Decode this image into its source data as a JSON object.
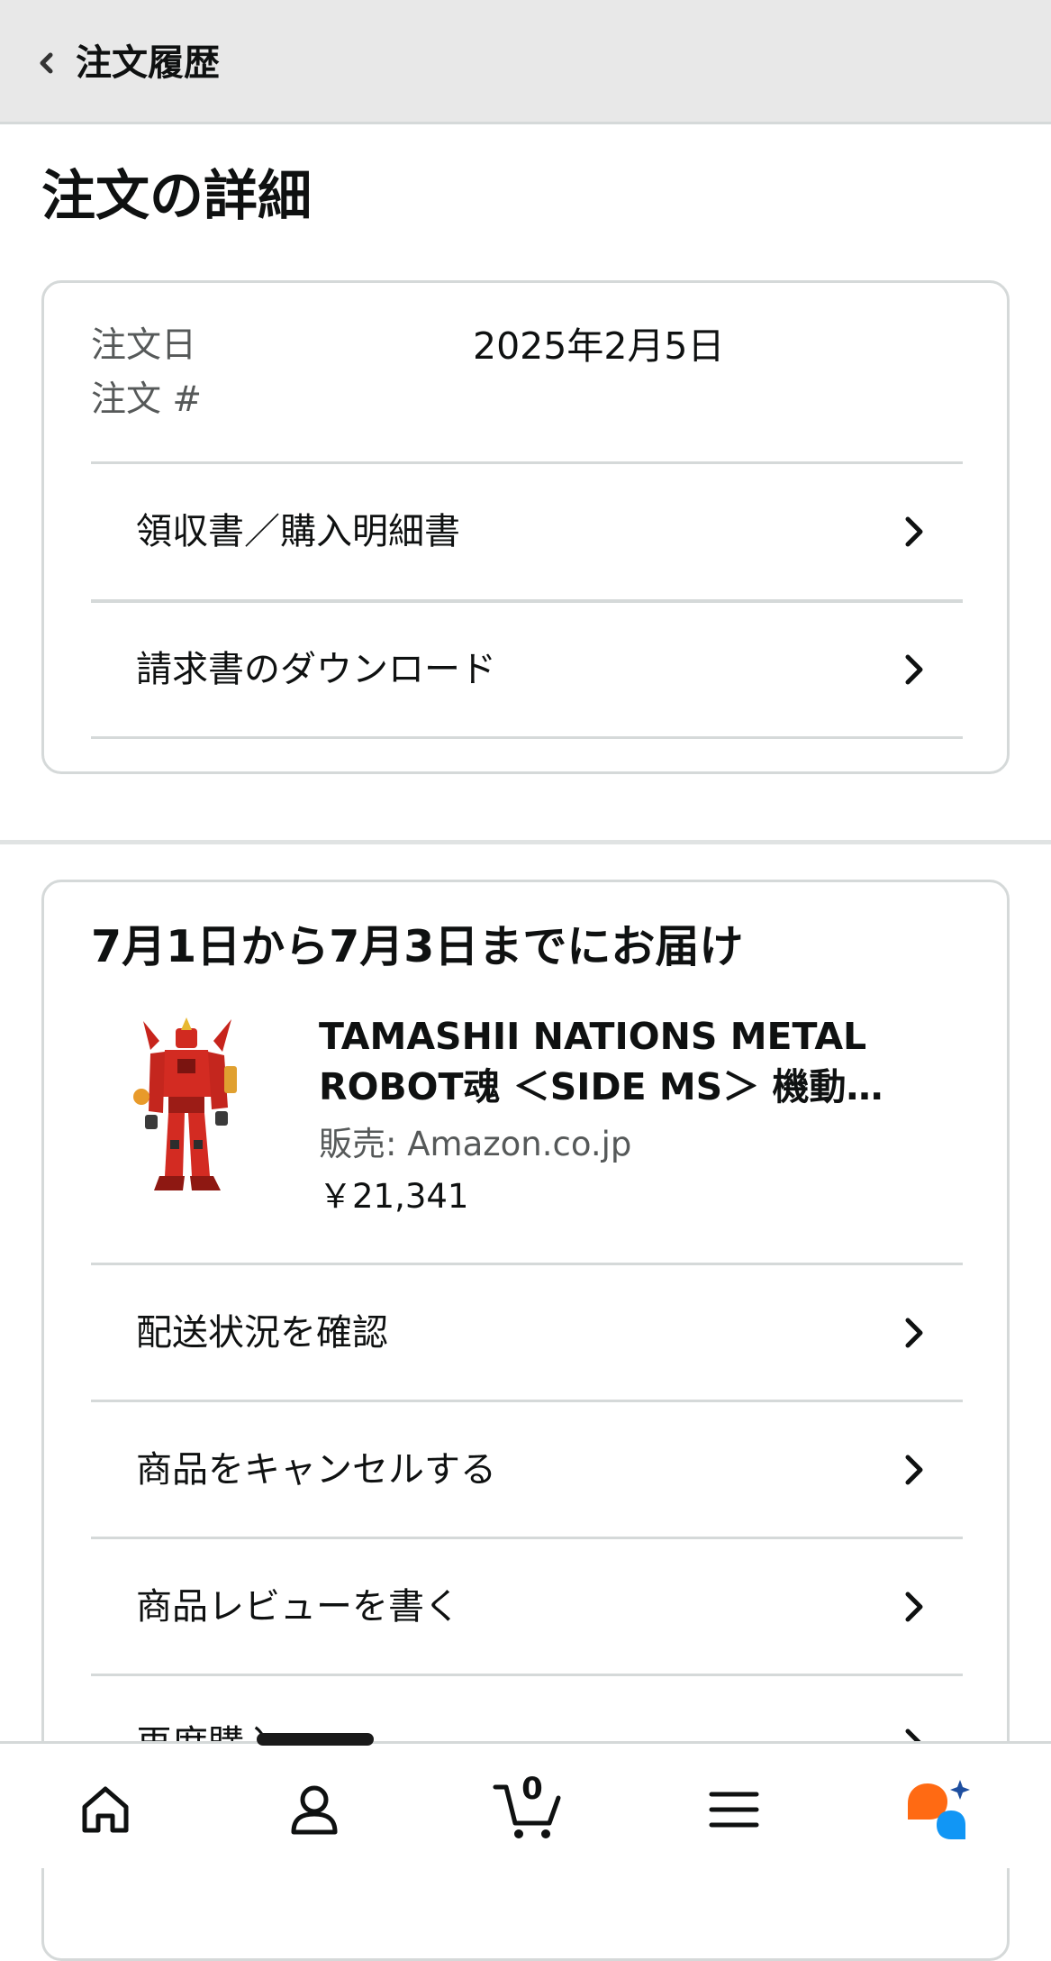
{
  "header": {
    "back_title": "注文履歴"
  },
  "page": {
    "title": "注文の詳細"
  },
  "order_info": {
    "date_label": "注文日",
    "date_value": "2025年2月5日",
    "number_label": "注文 #",
    "links": [
      {
        "label": "領収書／購入明細書"
      },
      {
        "label": "請求書のダウンロード"
      }
    ]
  },
  "delivery": {
    "heading": "7月1日から7月3日までにお届け",
    "product": {
      "title_line1": "TAMASHII NATIONS METAL",
      "title_line2": "ROBOT魂 ＜SIDE MS＞ 機動…",
      "seller": "販売: Amazon.co.jp",
      "price": "￥21,341",
      "image_icon": "red-robot-figure-image"
    },
    "actions": [
      {
        "label": "配送状況を確認"
      },
      {
        "label": "商品をキャンセルする"
      },
      {
        "label": "商品レビューを書く"
      },
      {
        "label": "再度購入"
      }
    ]
  },
  "bottom_nav": {
    "items": [
      {
        "icon": "home-icon"
      },
      {
        "icon": "account-icon"
      },
      {
        "icon": "cart-icon",
        "count": "0"
      },
      {
        "icon": "menu-icon"
      },
      {
        "icon": "rufus-ai-icon"
      }
    ]
  },
  "colors": {
    "accent_orange": "#ff6a13",
    "accent_blue": "#1196f5",
    "text_primary": "#0f1111",
    "text_secondary": "#565959",
    "divider": "#d5d9d9"
  }
}
